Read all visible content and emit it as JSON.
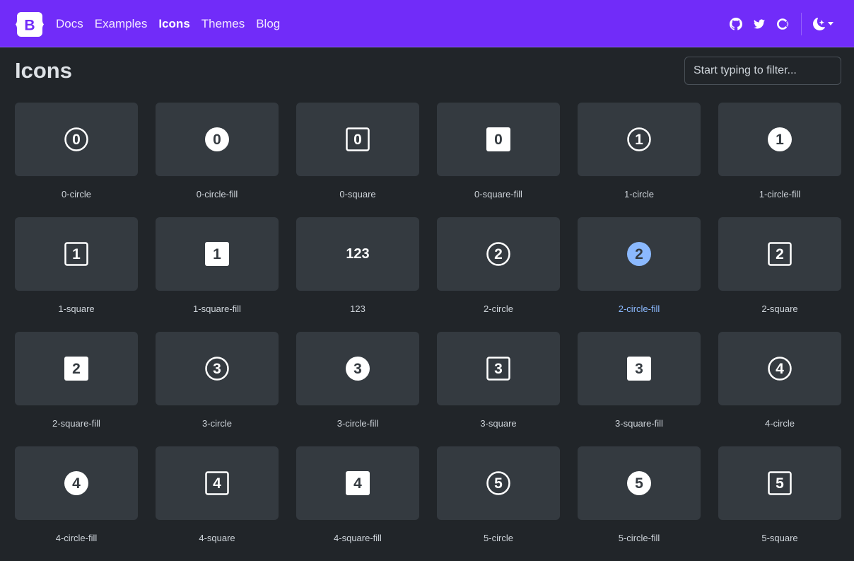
{
  "nav": {
    "brand_letter": "B",
    "links": [
      {
        "label": "Docs",
        "active": false
      },
      {
        "label": "Examples",
        "active": false
      },
      {
        "label": "Icons",
        "active": true
      },
      {
        "label": "Themes",
        "active": false
      },
      {
        "label": "Blog",
        "active": false
      }
    ],
    "icons": [
      "github-icon",
      "twitter-icon",
      "opencollective-icon"
    ],
    "theme_icon": "moon-stars-icon",
    "accent_color": "#712cf9"
  },
  "page": {
    "title": "Icons",
    "search_placeholder": "Start typing to filter..."
  },
  "icons": [
    {
      "name": "0-circle",
      "glyph": "0",
      "shape": "circle"
    },
    {
      "name": "0-circle-fill",
      "glyph": "0",
      "shape": "circle-fill"
    },
    {
      "name": "0-square",
      "glyph": "0",
      "shape": "square"
    },
    {
      "name": "0-square-fill",
      "glyph": "0",
      "shape": "square-fill"
    },
    {
      "name": "1-circle",
      "glyph": "1",
      "shape": "circle"
    },
    {
      "name": "1-circle-fill",
      "glyph": "1",
      "shape": "circle-fill"
    },
    {
      "name": "1-square",
      "glyph": "1",
      "shape": "square"
    },
    {
      "name": "1-square-fill",
      "glyph": "1",
      "shape": "square-fill"
    },
    {
      "name": "123",
      "glyph": "123",
      "shape": "text"
    },
    {
      "name": "2-circle",
      "glyph": "2",
      "shape": "circle"
    },
    {
      "name": "2-circle-fill",
      "glyph": "2",
      "shape": "circle-fill",
      "selected": true
    },
    {
      "name": "2-square",
      "glyph": "2",
      "shape": "square"
    },
    {
      "name": "2-square-fill",
      "glyph": "2",
      "shape": "square-fill"
    },
    {
      "name": "3-circle",
      "glyph": "3",
      "shape": "circle"
    },
    {
      "name": "3-circle-fill",
      "glyph": "3",
      "shape": "circle-fill"
    },
    {
      "name": "3-square",
      "glyph": "3",
      "shape": "square"
    },
    {
      "name": "3-square-fill",
      "glyph": "3",
      "shape": "square-fill"
    },
    {
      "name": "4-circle",
      "glyph": "4",
      "shape": "circle"
    },
    {
      "name": "4-circle-fill",
      "glyph": "4",
      "shape": "circle-fill"
    },
    {
      "name": "4-square",
      "glyph": "4",
      "shape": "square"
    },
    {
      "name": "4-square-fill",
      "glyph": "4",
      "shape": "square-fill"
    },
    {
      "name": "5-circle",
      "glyph": "5",
      "shape": "circle"
    },
    {
      "name": "5-circle-fill",
      "glyph": "5",
      "shape": "circle-fill"
    },
    {
      "name": "5-square",
      "glyph": "5",
      "shape": "square"
    }
  ],
  "colors": {
    "background": "#212529",
    "tile": "#343a40",
    "selected": "#8bb9fe"
  }
}
